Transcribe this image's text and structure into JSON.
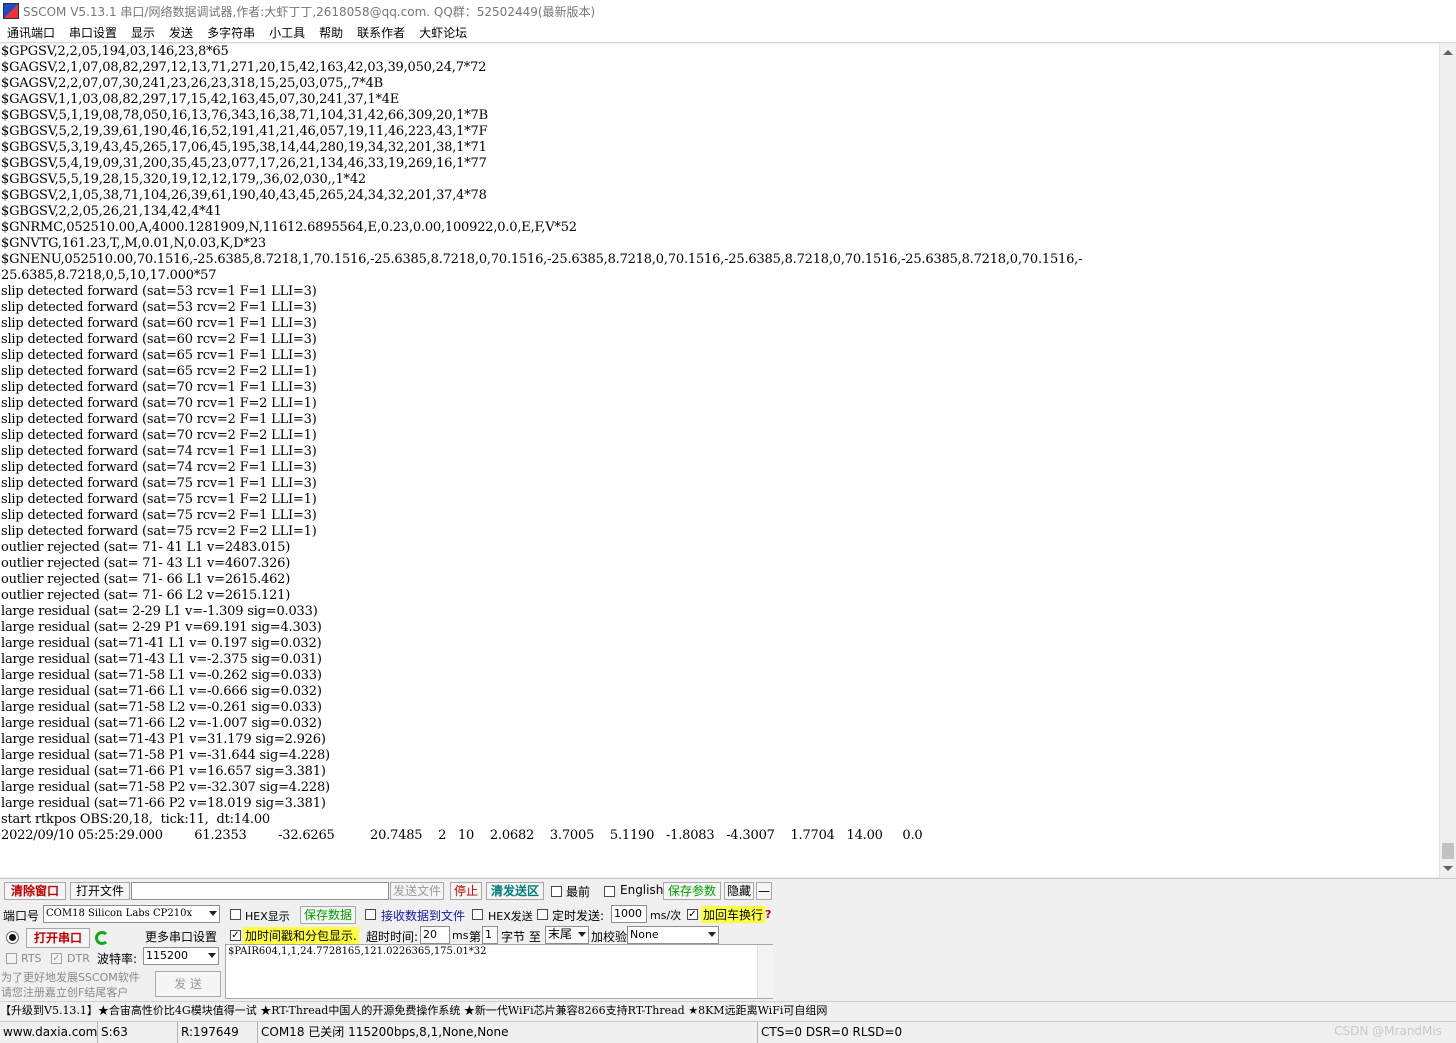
{
  "window": {
    "title": "SSCOM V5.13.1 串口/网络数据调试器,作者:大虾丁丁,2618058@qq.com. QQ群：52502449(最新版本)"
  },
  "menu": [
    "通讯端口",
    "串口设置",
    "显示",
    "发送",
    "多字符串",
    "小工具",
    "帮助",
    "联系作者",
    "大虾论坛"
  ],
  "console_lines": [
    "$GPGSV,2,2,05,194,03,146,23,8*65",
    "$GAGSV,2,1,07,08,82,297,12,13,71,271,20,15,42,163,42,03,39,050,24,7*72",
    "$GAGSV,2,2,07,07,30,241,23,26,23,318,15,25,03,075,,7*4B",
    "$GAGSV,1,1,03,08,82,297,17,15,42,163,45,07,30,241,37,1*4E",
    "$GBGSV,5,1,19,08,78,050,16,13,76,343,16,38,71,104,31,42,66,309,20,1*7B",
    "$GBGSV,5,2,19,39,61,190,46,16,52,191,41,21,46,057,19,11,46,223,43,1*7F",
    "$GBGSV,5,3,19,43,45,265,17,06,45,195,38,14,44,280,19,34,32,201,38,1*71",
    "$GBGSV,5,4,19,09,31,200,35,45,23,077,17,26,21,134,46,33,19,269,16,1*77",
    "$GBGSV,5,5,19,28,15,320,19,12,12,179,,36,02,030,,1*42",
    "$GBGSV,2,1,05,38,71,104,26,39,61,190,40,43,45,265,24,34,32,201,37,4*78",
    "$GBGSV,2,2,05,26,21,134,42,4*41",
    "$GNRMC,052510.00,A,4000.1281909,N,11612.6895564,E,0.23,0.00,100922,0.0,E,F,V*52",
    "$GNVTG,161.23,T,,M,0.01,N,0.03,K,D*23",
    "$GNENU,052510.00,70.1516,-25.6385,8.7218,1,70.1516,-25.6385,8.7218,0,70.1516,-25.6385,8.7218,0,70.1516,-25.6385,8.7218,0,70.1516,-25.6385,8.7218,0,70.1516,-",
    "25.6385,8.7218,0,5,10,17.000*57",
    "slip detected forward (sat=53 rcv=1 F=1 LLI=3)",
    "slip detected forward (sat=53 rcv=2 F=1 LLI=3)",
    "slip detected forward (sat=60 rcv=1 F=1 LLI=3)",
    "slip detected forward (sat=60 rcv=2 F=1 LLI=3)",
    "slip detected forward (sat=65 rcv=1 F=1 LLI=3)",
    "slip detected forward (sat=65 rcv=2 F=2 LLI=1)",
    "slip detected forward (sat=70 rcv=1 F=1 LLI=3)",
    "slip detected forward (sat=70 rcv=1 F=2 LLI=1)",
    "slip detected forward (sat=70 rcv=2 F=1 LLI=3)",
    "slip detected forward (sat=70 rcv=2 F=2 LLI=1)",
    "slip detected forward (sat=74 rcv=1 F=1 LLI=3)",
    "slip detected forward (sat=74 rcv=2 F=1 LLI=3)",
    "slip detected forward (sat=75 rcv=1 F=1 LLI=3)",
    "slip detected forward (sat=75 rcv=1 F=2 LLI=1)",
    "slip detected forward (sat=75 rcv=2 F=1 LLI=3)",
    "slip detected forward (sat=75 rcv=2 F=2 LLI=1)",
    "outlier rejected (sat= 71- 41 L1 v=2483.015)",
    "outlier rejected (sat= 71- 43 L1 v=4607.326)",
    "outlier rejected (sat= 71- 66 L1 v=2615.462)",
    "outlier rejected (sat= 71- 66 L2 v=2615.121)",
    "large residual (sat= 2-29 L1 v=-1.309 sig=0.033)",
    "large residual (sat= 2-29 P1 v=69.191 sig=4.303)",
    "large residual (sat=71-41 L1 v= 0.197 sig=0.032)",
    "large residual (sat=71-43 L1 v=-2.375 sig=0.031)",
    "large residual (sat=71-58 L1 v=-0.262 sig=0.033)",
    "large residual (sat=71-66 L1 v=-0.666 sig=0.032)",
    "large residual (sat=71-58 L2 v=-0.261 sig=0.033)",
    "large residual (sat=71-66 L2 v=-1.007 sig=0.032)",
    "large residual (sat=71-43 P1 v=31.179 sig=2.926)",
    "large residual (sat=71-58 P1 v=-31.644 sig=4.228)",
    "large residual (sat=71-66 P1 v=16.657 sig=3.381)",
    "large residual (sat=71-58 P2 v=-32.307 sig=4.228)",
    "large residual (sat=71-66 P2 v=18.019 sig=3.381)",
    "start rtkpos OBS:20,18,  tick:11,  dt:14.00",
    "2022/09/10 05:25:29.000        61.2353        -32.6265         20.7485    2   10    2.0682    3.7005    5.1190   -1.8083   -4.3007    1.7704   14.00     0.0"
  ],
  "toolbar": {
    "clear_window": "清除窗口",
    "open_file": "打开文件",
    "file_path": "",
    "send_file": "发送文件",
    "stop": "停止",
    "clear_send": "清发送区",
    "top_most": "最前",
    "english": "English",
    "save_params": "保存参数",
    "hide": "隐藏",
    "collapse": "—"
  },
  "port": {
    "port_label": "端口号",
    "port_value": "COM18 Silicon Labs CP210x",
    "open_port": "打开串口",
    "more_settings": "更多串口设置",
    "baud_label": "波特率:",
    "baud_value": "115200",
    "rts": "RTS",
    "dtr": "DTR",
    "promo_line1": "为了更好地发展SSCOM软件",
    "promo_line2": "请您注册嘉立创F结尾客户",
    "send_button": "发  送"
  },
  "options": {
    "hex_display": "HEX显示",
    "save_data": "保存数据",
    "recv_to_file": "接收数据到文件",
    "hex_send": "HEX发送",
    "timed_send": "定时发送:",
    "interval_value": "1000",
    "interval_unit": "ms/次",
    "add_crlf": "加回车换行",
    "help_mark": "?",
    "timestamp": "加时间戳和分包显示.",
    "timeout_label": "超时时间:",
    "timeout_value": "20",
    "timeout_unit": "ms",
    "nth_label": "第",
    "nth_value": "1",
    "byte_to": "字节 至",
    "end_value": "末尾",
    "checksum_label": "加校验",
    "checksum_value": "None"
  },
  "send_text": "$PAIR604,1,1,24.7728165,121.0226365,175.01*32",
  "ad_text": "【升级到V5.13.1】★合宙高性价比4G模块值得一试 ★RT-Thread中国人的开源免费操作系统 ★新一代WiFi芯片兼容8266支持RT-Thread ★8KM远距离WiFi可自组网",
  "status": {
    "website": "www.daxia.com",
    "sent": "S:63",
    "received": "R:197649",
    "port_state": "COM18 已关闭  115200bps,8,1,None,None",
    "lines": "CTS=0 DSR=0 RLSD=0",
    "watermark": "CSDN @MrandMis"
  }
}
